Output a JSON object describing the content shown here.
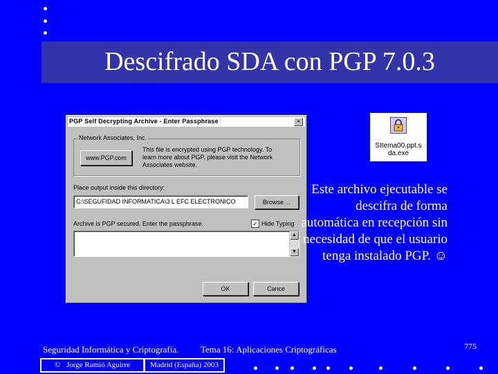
{
  "slide": {
    "title": "Descifrado SDA con PGP 7.0.3",
    "description": "Este archivo ejecutable se descifra de forma automática en recepción sin necesidad de que el usuario tenga instalado PGP. ☺",
    "footer_left": "Seguridad Informática y Criptografía.",
    "footer_topic": "Tema 16: Aplicaciones Criptográficas",
    "page_number": "775",
    "credit_symbol": "©",
    "credit_author": "Jorge Ramió Aguirre",
    "credit_place": "Madrid (España) 2003"
  },
  "dialog": {
    "title": "PGP Self Decrypting Archive - Enter Passphrase",
    "close_label": "×",
    "group_label": "Network Associates, Inc.",
    "link_button": "www.PGP.com",
    "info_text": "This file is encrypted using PGP technology. To learn more about PGP, please visit the Network Associates website.",
    "output_label": "Place output inside this directory:",
    "output_path": "C:\\SEGUFIDAD INFORMATICA\\3 L EFC ELECTRONICO",
    "browse_label": "Browse ...",
    "passphrase_label": "Archive is PGP secured. Enter the passphrase:",
    "hide_typing_label": "Hide Typing",
    "hide_typing_checked": true,
    "check_mark": "✓",
    "passphrase_value": "",
    "ok_label": "OK",
    "cancel_label": "Cance"
  },
  "file_icon": {
    "label": "SItema00.ppt.s da.exe",
    "icon": "lock-file-icon"
  },
  "colors": {
    "background": "#0000fe",
    "title_band": "#3333aa",
    "dialog_face": "#c0c0c0"
  }
}
